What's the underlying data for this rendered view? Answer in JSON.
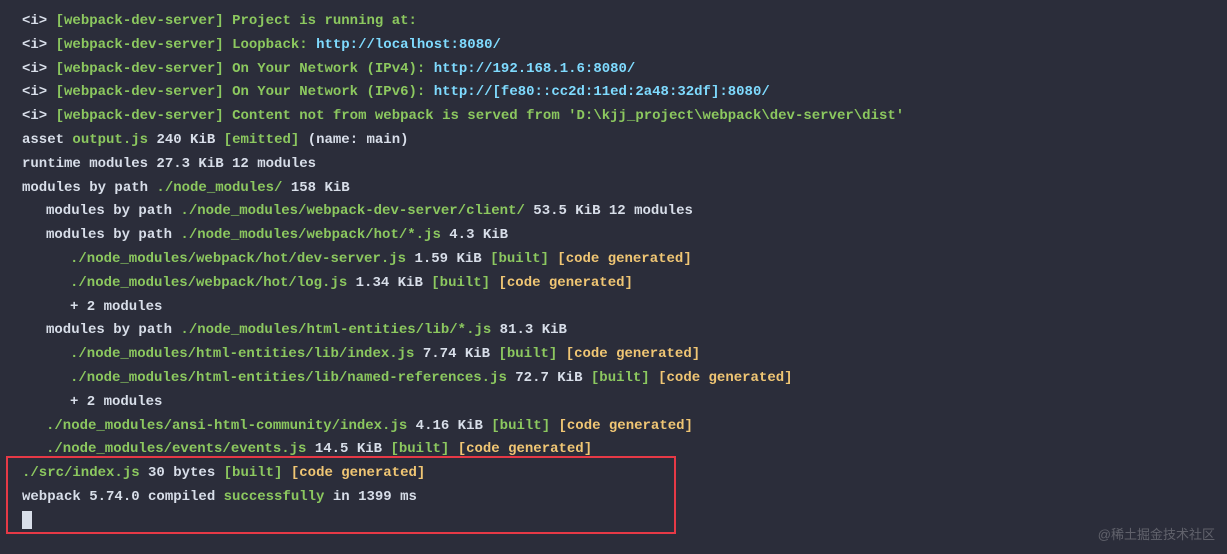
{
  "prefix": {
    "i": "<i>",
    "tag": "[webpack-dev-server]"
  },
  "lines": {
    "l1": {
      "msg": "Project is running at:"
    },
    "l2": {
      "msg": "Loopback: ",
      "url": "http://localhost:8080/"
    },
    "l3": {
      "msg": "On Your Network (IPv4): ",
      "url": "http://192.168.1.6:8080/"
    },
    "l4": {
      "msg": "On Your Network (IPv6): ",
      "url": "http://[fe80::cc2d:11ed:2a48:32df]:8080/"
    },
    "l5": {
      "msg": "Content not from webpack is served from ",
      "path": "'D:\\kjj_project\\webpack\\dev-server\\dist'"
    },
    "l6": {
      "a": "asset ",
      "file": "output.js",
      "b": " 240 KiB ",
      "tag": "[emitted]",
      "c": " (name: main)"
    },
    "l7": "runtime modules 27.3 KiB 12 modules",
    "l8": {
      "a": "modules by path ",
      "path": "./node_modules/",
      "b": " 158 KiB"
    },
    "l9": {
      "a": "modules by path ",
      "path": "./node_modules/webpack-dev-server/client/",
      "b": " 53.5 KiB 12 modules"
    },
    "l10": {
      "a": "modules by path ",
      "path": "./node_modules/webpack/hot/*.js",
      "b": " 4.3 KiB"
    },
    "l11": {
      "path": "./node_modules/webpack/hot/dev-server.js",
      "size": " 1.59 KiB ",
      "built": "[built]",
      "sp": " ",
      "gen": "[code generated]"
    },
    "l12": {
      "path": "./node_modules/webpack/hot/log.js",
      "size": " 1.34 KiB ",
      "built": "[built]",
      "sp": " ",
      "gen": "[code generated]"
    },
    "l13": "+ 2 modules",
    "l14": {
      "a": "modules by path ",
      "path": "./node_modules/html-entities/lib/*.js",
      "b": " 81.3 KiB"
    },
    "l15": {
      "path": "./node_modules/html-entities/lib/index.js",
      "size": " 7.74 KiB ",
      "built": "[built]",
      "sp": " ",
      "gen": "[code generated]"
    },
    "l16": {
      "path": "./node_modules/html-entities/lib/named-references.js",
      "size": " 72.7 KiB ",
      "built": "[built]",
      "sp": " ",
      "gen": "[code generated]"
    },
    "l17": "+ 2 modules",
    "l18": {
      "path": "./node_modules/ansi-html-community/index.js",
      "size": " 4.16 KiB ",
      "built": "[built]",
      "sp": " ",
      "gen": "[code generated]"
    },
    "l19": {
      "path": "./node_modules/events/events.js",
      "size": " 14.5 KiB ",
      "built": "[built]",
      "sp": " ",
      "gen": "[code generated]"
    },
    "l20": {
      "path": "./src/index.js",
      "size": " 30 bytes ",
      "built": "[built]",
      "sp": " ",
      "gen": "[code generated]"
    },
    "l21": {
      "a": "webpack 5.74.0 compiled ",
      "ok": "successfully",
      "b": " in 1399 ms"
    }
  },
  "watermark": "@稀土掘金技术社区"
}
